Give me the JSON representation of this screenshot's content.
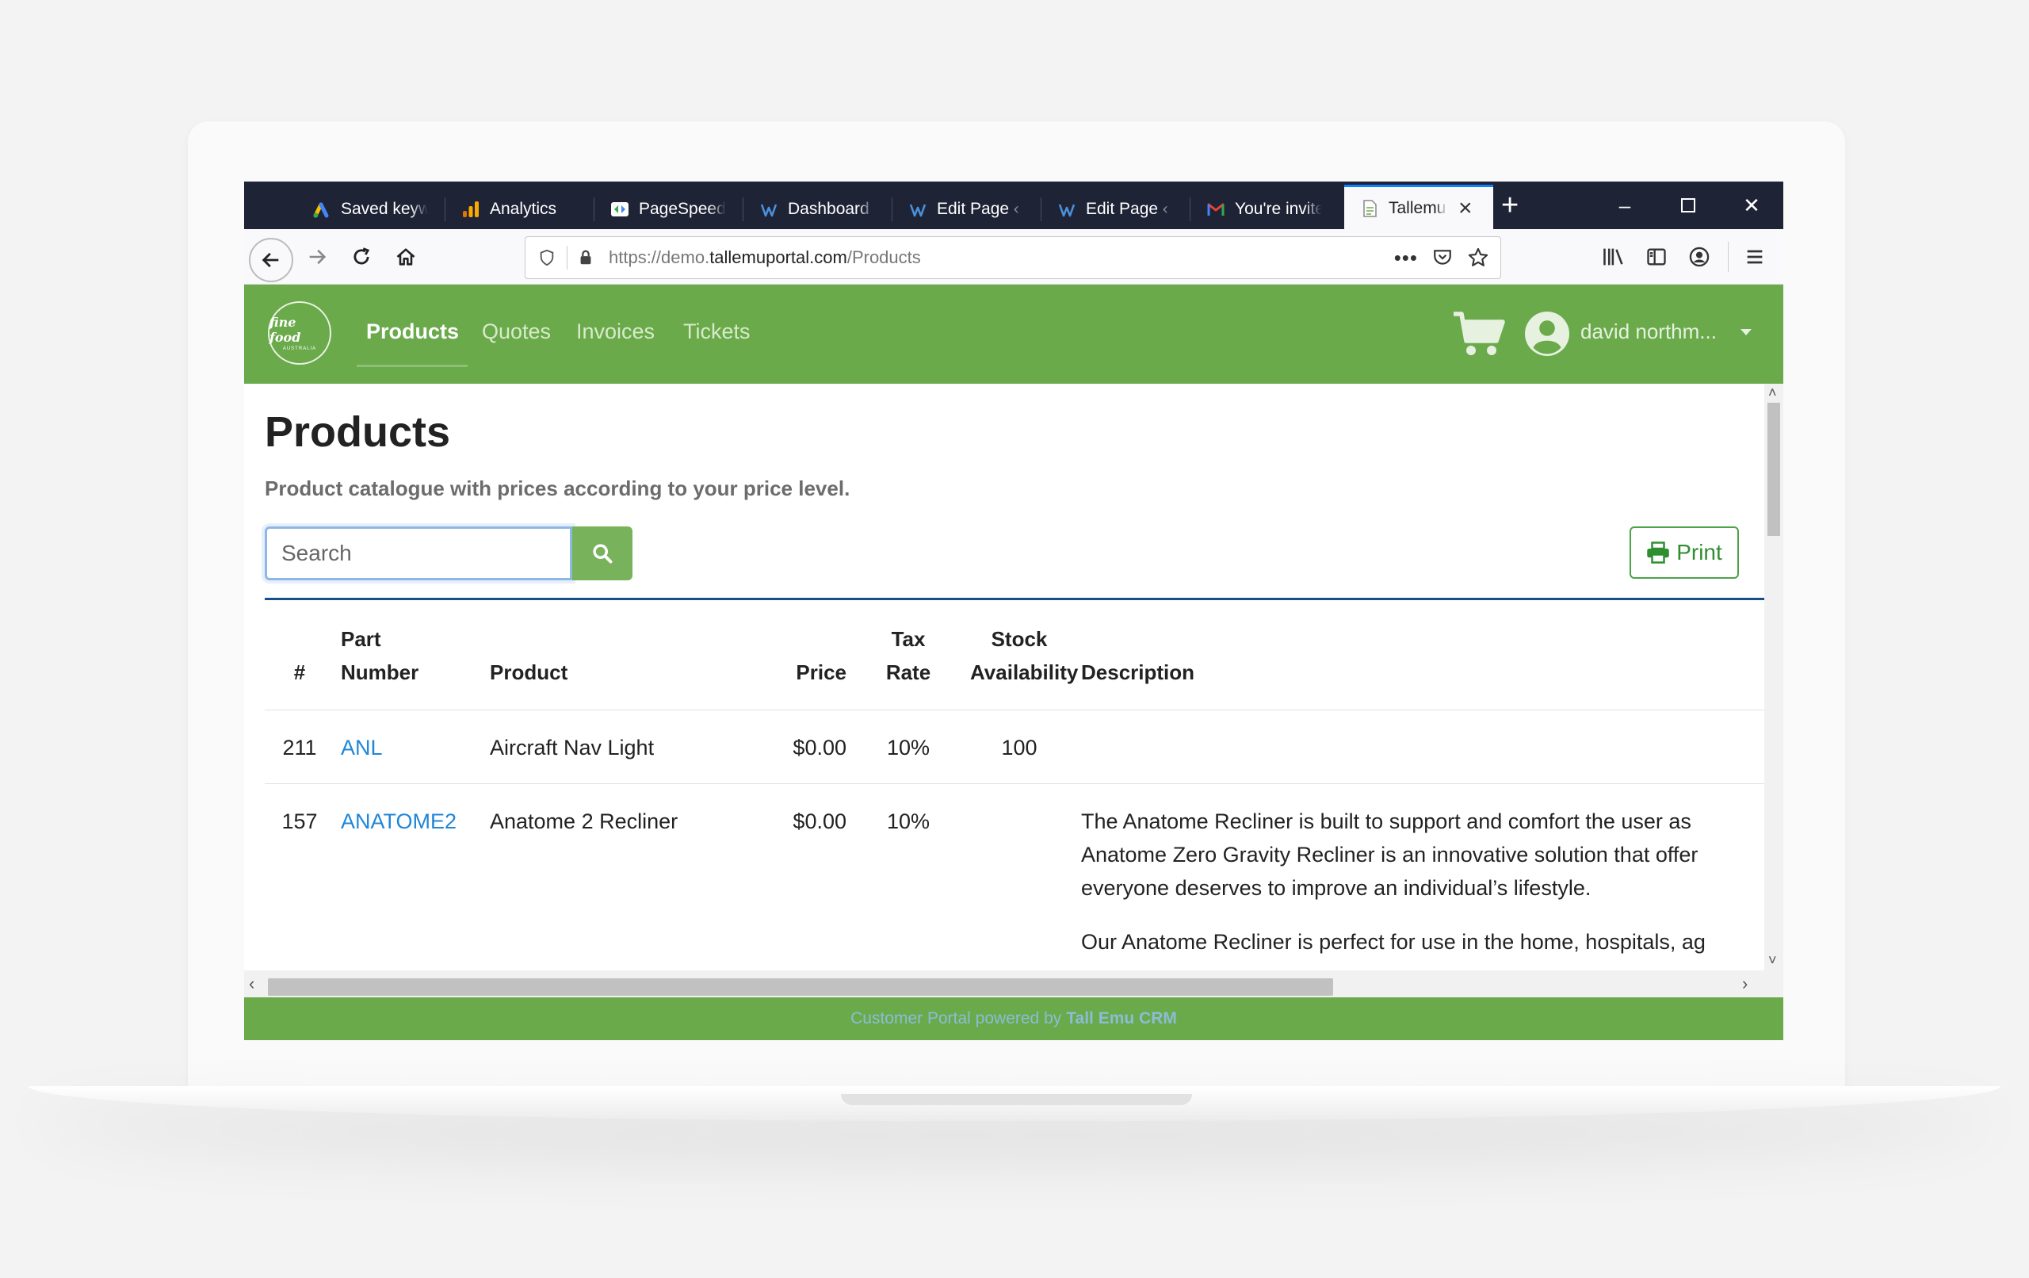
{
  "browser": {
    "tabs": [
      {
        "label": "Saved keywords",
        "icon": "google-ads-icon"
      },
      {
        "label": "Analytics",
        "icon": "analytics-icon"
      },
      {
        "label": "PageSpeed Insights",
        "icon": "pagespeed-icon"
      },
      {
        "label": "Dashboard ‹ Tallemu",
        "icon": "wordpress-icon"
      },
      {
        "label": "Edit Page ‹ Tallemu",
        "icon": "wordpress-icon"
      },
      {
        "label": "Edit Page ‹ Tallemu",
        "icon": "wordpress-icon"
      },
      {
        "label": "You're invited",
        "icon": "gmail-icon"
      },
      {
        "label": "Tallemu Portal",
        "icon": "page-icon",
        "active": true
      }
    ],
    "url_prefix": "https://demo.",
    "url_domain": "tallemuportal.com",
    "url_path": "/Products"
  },
  "header": {
    "logo_text": "fine food",
    "logo_sub": "AUSTRALIA",
    "menu": [
      {
        "label": "Products",
        "active": true
      },
      {
        "label": "Quotes"
      },
      {
        "label": "Invoices"
      },
      {
        "label": "Tickets"
      }
    ],
    "user_name": "david northm..."
  },
  "page": {
    "title": "Products",
    "subtitle": "Product catalogue with prices according to your price level.",
    "search_placeholder": "Search",
    "print_label": "Print"
  },
  "table": {
    "headers": {
      "num": "#",
      "part_line1": "Part",
      "part_line2": "Number",
      "product": "Product",
      "price": "Price",
      "tax_line1": "Tax",
      "tax_line2": "Rate",
      "stock_line1": "Stock",
      "stock_line2": "Availability",
      "description": "Description"
    },
    "rows": [
      {
        "num": "211",
        "part": "ANL",
        "product": "Aircraft Nav Light",
        "price": "$0.00",
        "tax": "10%",
        "stock": "100",
        "desc_line1": "",
        "desc_line2": "",
        "desc_line3": "",
        "desc_para2": ""
      },
      {
        "num": "157",
        "part": "ANATOME2",
        "product": "Anatome 2 Recliner",
        "price": "$0.00",
        "tax": "10%",
        "stock": "",
        "desc_line1": "The Anatome Recliner is built to support and comfort the user as",
        "desc_line2": "Anatome Zero Gravity Recliner is an innovative solution that offer",
        "desc_line3": "everyone deserves to improve an individual’s lifestyle.",
        "desc_para2": "Our Anatome Recliner is perfect for use in the home, hospitals, ag"
      }
    ]
  },
  "footer": {
    "text": "Customer Portal powered by",
    "brand": "Tall Emu CRM"
  },
  "colors": {
    "header_green": "#6aaa4b",
    "tab_bar": "#1f2336",
    "link_blue": "#1f86d8",
    "divider_navy": "#174f8a"
  }
}
